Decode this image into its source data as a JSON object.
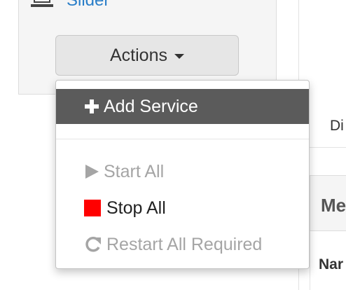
{
  "sidebar": {
    "slider_label": "Slider"
  },
  "actions": {
    "label": "Actions"
  },
  "menu": {
    "items": [
      {
        "label": "Add Service",
        "icon": "plus-icon",
        "state": "active"
      },
      {
        "label": "Start All",
        "icon": "play-icon",
        "state": "disabled"
      },
      {
        "label": "Stop All",
        "icon": "stop-icon",
        "state": "enabled"
      },
      {
        "label": "Restart All Required",
        "icon": "refresh-icon",
        "state": "disabled"
      }
    ]
  },
  "background_fragments": {
    "di": "Di",
    "me": "Me",
    "nar": "Nar"
  },
  "colors": {
    "link": "#2a7ec8",
    "active_item_bg": "#5b5b5b",
    "stop_icon": "#ff0000",
    "disabled_text": "#a5a5a5"
  }
}
